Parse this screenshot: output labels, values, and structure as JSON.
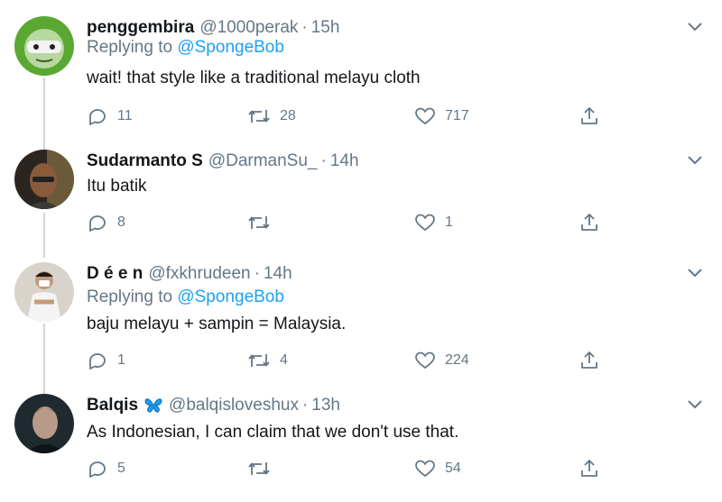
{
  "tweets": [
    {
      "name": "penggembira",
      "handle": "@1000perak",
      "separator": "·",
      "time": "15h",
      "replying_prefix": "Replying to",
      "replying_to": "@SpongeBob",
      "text": "wait! that style like a traditional melayu cloth",
      "replies": "11",
      "retweets": "28",
      "likes": "717"
    },
    {
      "name": "Sudarmanto S",
      "handle": "@DarmanSu_",
      "separator": "·",
      "time": "14h",
      "text": "Itu batik",
      "replies": "8",
      "retweets": "",
      "likes": "1"
    },
    {
      "name": "D é e n",
      "handle": "@fxkhrudeen",
      "separator": "·",
      "time": "14h",
      "replying_prefix": "Replying to",
      "replying_to": "@SpongeBob",
      "text": "baju melayu + sampin = Malaysia.",
      "replies": "1",
      "retweets": "4",
      "likes": "224"
    },
    {
      "name": "Balqis",
      "name_emoji": "butterfly-icon",
      "handle": "@balqisloveshux",
      "separator": "·",
      "time": "13h",
      "text": "As Indonesian, I can claim that we don't use that.",
      "replies": "5",
      "retweets": "",
      "likes": "54"
    }
  ],
  "colors": {
    "text": "#14171a",
    "secondary": "#657786",
    "link": "#1da1f2",
    "thread_line": "#ccd6dd",
    "butterfly": "#1d9bf0"
  }
}
